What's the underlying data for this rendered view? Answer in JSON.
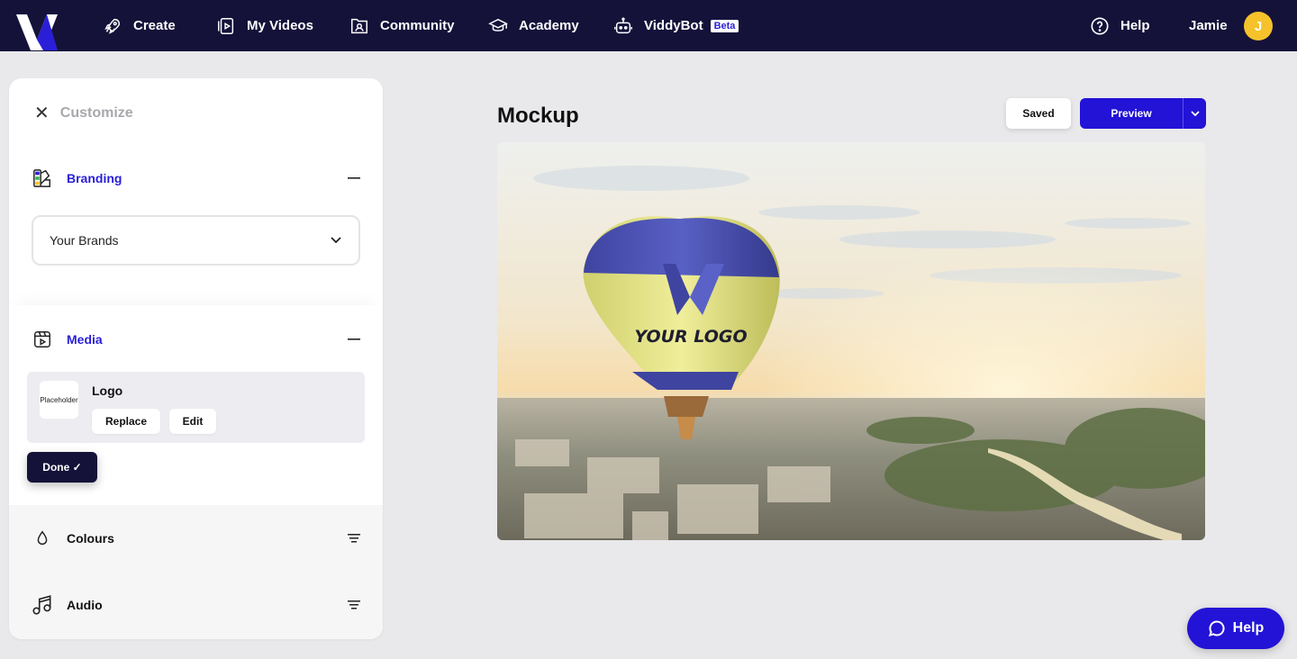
{
  "nav": {
    "items": [
      {
        "label": "Create",
        "icon": "rocket-icon"
      },
      {
        "label": "My Videos",
        "icon": "videos-icon"
      },
      {
        "label": "Community",
        "icon": "community-icon"
      },
      {
        "label": "Academy",
        "icon": "graduation-cap-icon"
      },
      {
        "label": "ViddyBot",
        "icon": "robot-icon",
        "badge": "Beta"
      }
    ],
    "help_label": "Help",
    "user_name": "Jamie",
    "avatar_initial": "J"
  },
  "panel": {
    "title": "Customize",
    "sections": {
      "branding": {
        "label": "Branding"
      },
      "media": {
        "label": "Media"
      },
      "colours": {
        "label": "Colours"
      },
      "audio": {
        "label": "Audio"
      }
    },
    "brand_select": {
      "value": "Your Brands"
    },
    "logo_item": {
      "thumb_text": "Placeholder",
      "name": "Logo",
      "replace_label": "Replace",
      "edit_label": "Edit"
    },
    "done_label": "Done ✓"
  },
  "main": {
    "title": "Mockup",
    "saved_label": "Saved",
    "preview_label": "Preview",
    "balloon_text": "YOUR LOGO"
  },
  "help_fab": {
    "label": "Help"
  },
  "colors": {
    "nav_bg": "#15123a",
    "accent": "#2213d6",
    "active_label": "#2a1fd6",
    "avatar": "#f5c22b"
  }
}
